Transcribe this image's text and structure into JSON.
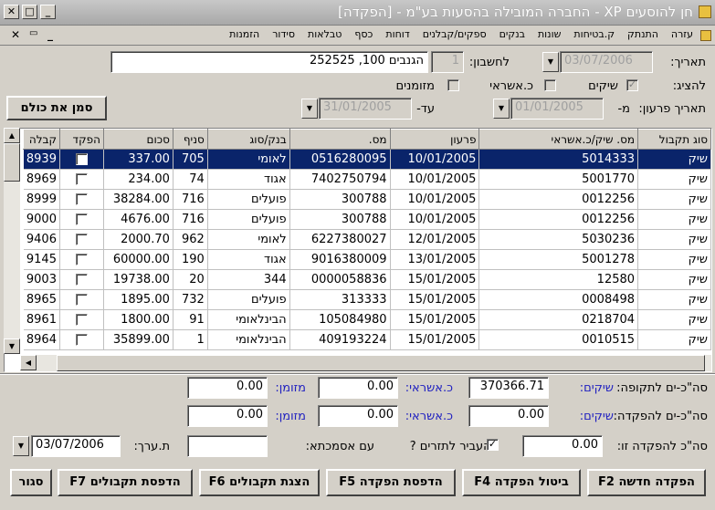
{
  "window": {
    "title": "חן להוסעים XP - החברה המובילה בהסעות בע\"מ - [הפקדה]",
    "mdi_controls": [
      "✕",
      "🗗",
      "_"
    ]
  },
  "menu": [
    "הזמנות",
    "סידור",
    "טבלאות",
    "כסף",
    "דוחות",
    "ספקים/קבלנים",
    "בנקים",
    "שונות",
    "ק.בטיחות",
    "התנתק",
    "עזרה"
  ],
  "header": {
    "date_label": "תאריך:",
    "date_value": "03/07/2006",
    "account_label": "לחשבון:",
    "account_num": "1",
    "account_name": "הגנבים 100, 252525",
    "show_label": "להציג:",
    "show_checks": "שיקים",
    "show_credit": "כ.אשראי",
    "show_cash": "מזומנים",
    "due_label": "תאריך פרעון:",
    "from_label": "מ-",
    "from_value": "01/01/2005",
    "to_label": "עד-",
    "to_value": "31/01/2005",
    "mark_all": "סמן את כולם"
  },
  "grid": {
    "columns": [
      "סוג תקבול",
      "מס. שיק/כ.אשראי",
      "פרעון",
      "מס.",
      "בנק/סוג",
      "סניף",
      "סכום",
      "הפקד",
      "קבלה"
    ],
    "rows": [
      {
        "type": "שיק",
        "check": "5014333",
        "due": "10/01/2005",
        "num": "0516280095",
        "bank": "לאומי",
        "branch": "705",
        "amount": "337.00",
        "deposit": false,
        "receipt": "8939"
      },
      {
        "type": "שיק",
        "check": "5001770",
        "due": "10/01/2005",
        "num": "7402750794",
        "bank": "אגוד",
        "branch": "74",
        "amount": "234.00",
        "deposit": false,
        "receipt": "8969"
      },
      {
        "type": "שיק",
        "check": "0012256",
        "due": "10/01/2005",
        "num": "300788",
        "bank": "פועלים",
        "branch": "716",
        "amount": "38284.00",
        "deposit": false,
        "receipt": "8999"
      },
      {
        "type": "שיק",
        "check": "0012256",
        "due": "10/01/2005",
        "num": "300788",
        "bank": "פועלים",
        "branch": "716",
        "amount": "4676.00",
        "deposit": false,
        "receipt": "9000"
      },
      {
        "type": "שיק",
        "check": "5030236",
        "due": "12/01/2005",
        "num": "6227380027",
        "bank": "לאומי",
        "branch": "962",
        "amount": "2000.70",
        "deposit": false,
        "receipt": "9406"
      },
      {
        "type": "שיק",
        "check": "5001278",
        "due": "13/01/2005",
        "num": "9016380009",
        "bank": "אגוד",
        "branch": "190",
        "amount": "60000.00",
        "deposit": false,
        "receipt": "9145"
      },
      {
        "type": "שיק",
        "check": "12580",
        "due": "15/01/2005",
        "num": "0000058836",
        "bank": "344",
        "branch": "20",
        "amount": "19738.00",
        "deposit": false,
        "receipt": "9003"
      },
      {
        "type": "שיק",
        "check": "0008498",
        "due": "15/01/2005",
        "num": "313333",
        "bank": "פועלים",
        "branch": "732",
        "amount": "1895.00",
        "deposit": false,
        "receipt": "8965"
      },
      {
        "type": "שיק",
        "check": "0218704",
        "due": "15/01/2005",
        "num": "105084980",
        "bank": "הבינלאומי",
        "branch": "91",
        "amount": "1800.00",
        "deposit": false,
        "receipt": "8961"
      },
      {
        "type": "שיק",
        "check": "0010515",
        "due": "15/01/2005",
        "num": "409193224",
        "bank": "הבינלאומי",
        "branch": "1",
        "amount": "35899.00",
        "deposit": false,
        "receipt": "8964"
      }
    ]
  },
  "totals": {
    "period_label": "סה\"כ-ים לתקופה:",
    "deposit_label": "סה\"כ-ים להפקדה:",
    "checks_label": "שיקים:",
    "credit_label": "כ.אשראי:",
    "cash_label": "מזומן:",
    "period_checks": "370366.71",
    "period_credit": "0.00",
    "period_cash": "0.00",
    "deposit_checks": "0.00",
    "deposit_credit": "0.00",
    "deposit_cash": "0.00",
    "this_deposit_label": "סה\"כ להפקדה זו:",
    "this_deposit": "0.00",
    "transfer_label": "להעביר לתזרים ?",
    "reference_label": "עם אסמכתא:",
    "reference_value": "",
    "value_date_label": "ת.ערך:",
    "value_date": "03/07/2006"
  },
  "buttons": {
    "new_deposit": "הפקדה חדשה F2",
    "cancel_deposit": "ביטול הפקדה F4",
    "print_deposit": "הדפסת הפקדה F5",
    "show_receipts": "הצגת תקבולים F6",
    "print_receipts": "הדפסת תקבולים F7",
    "close": "סגור"
  }
}
